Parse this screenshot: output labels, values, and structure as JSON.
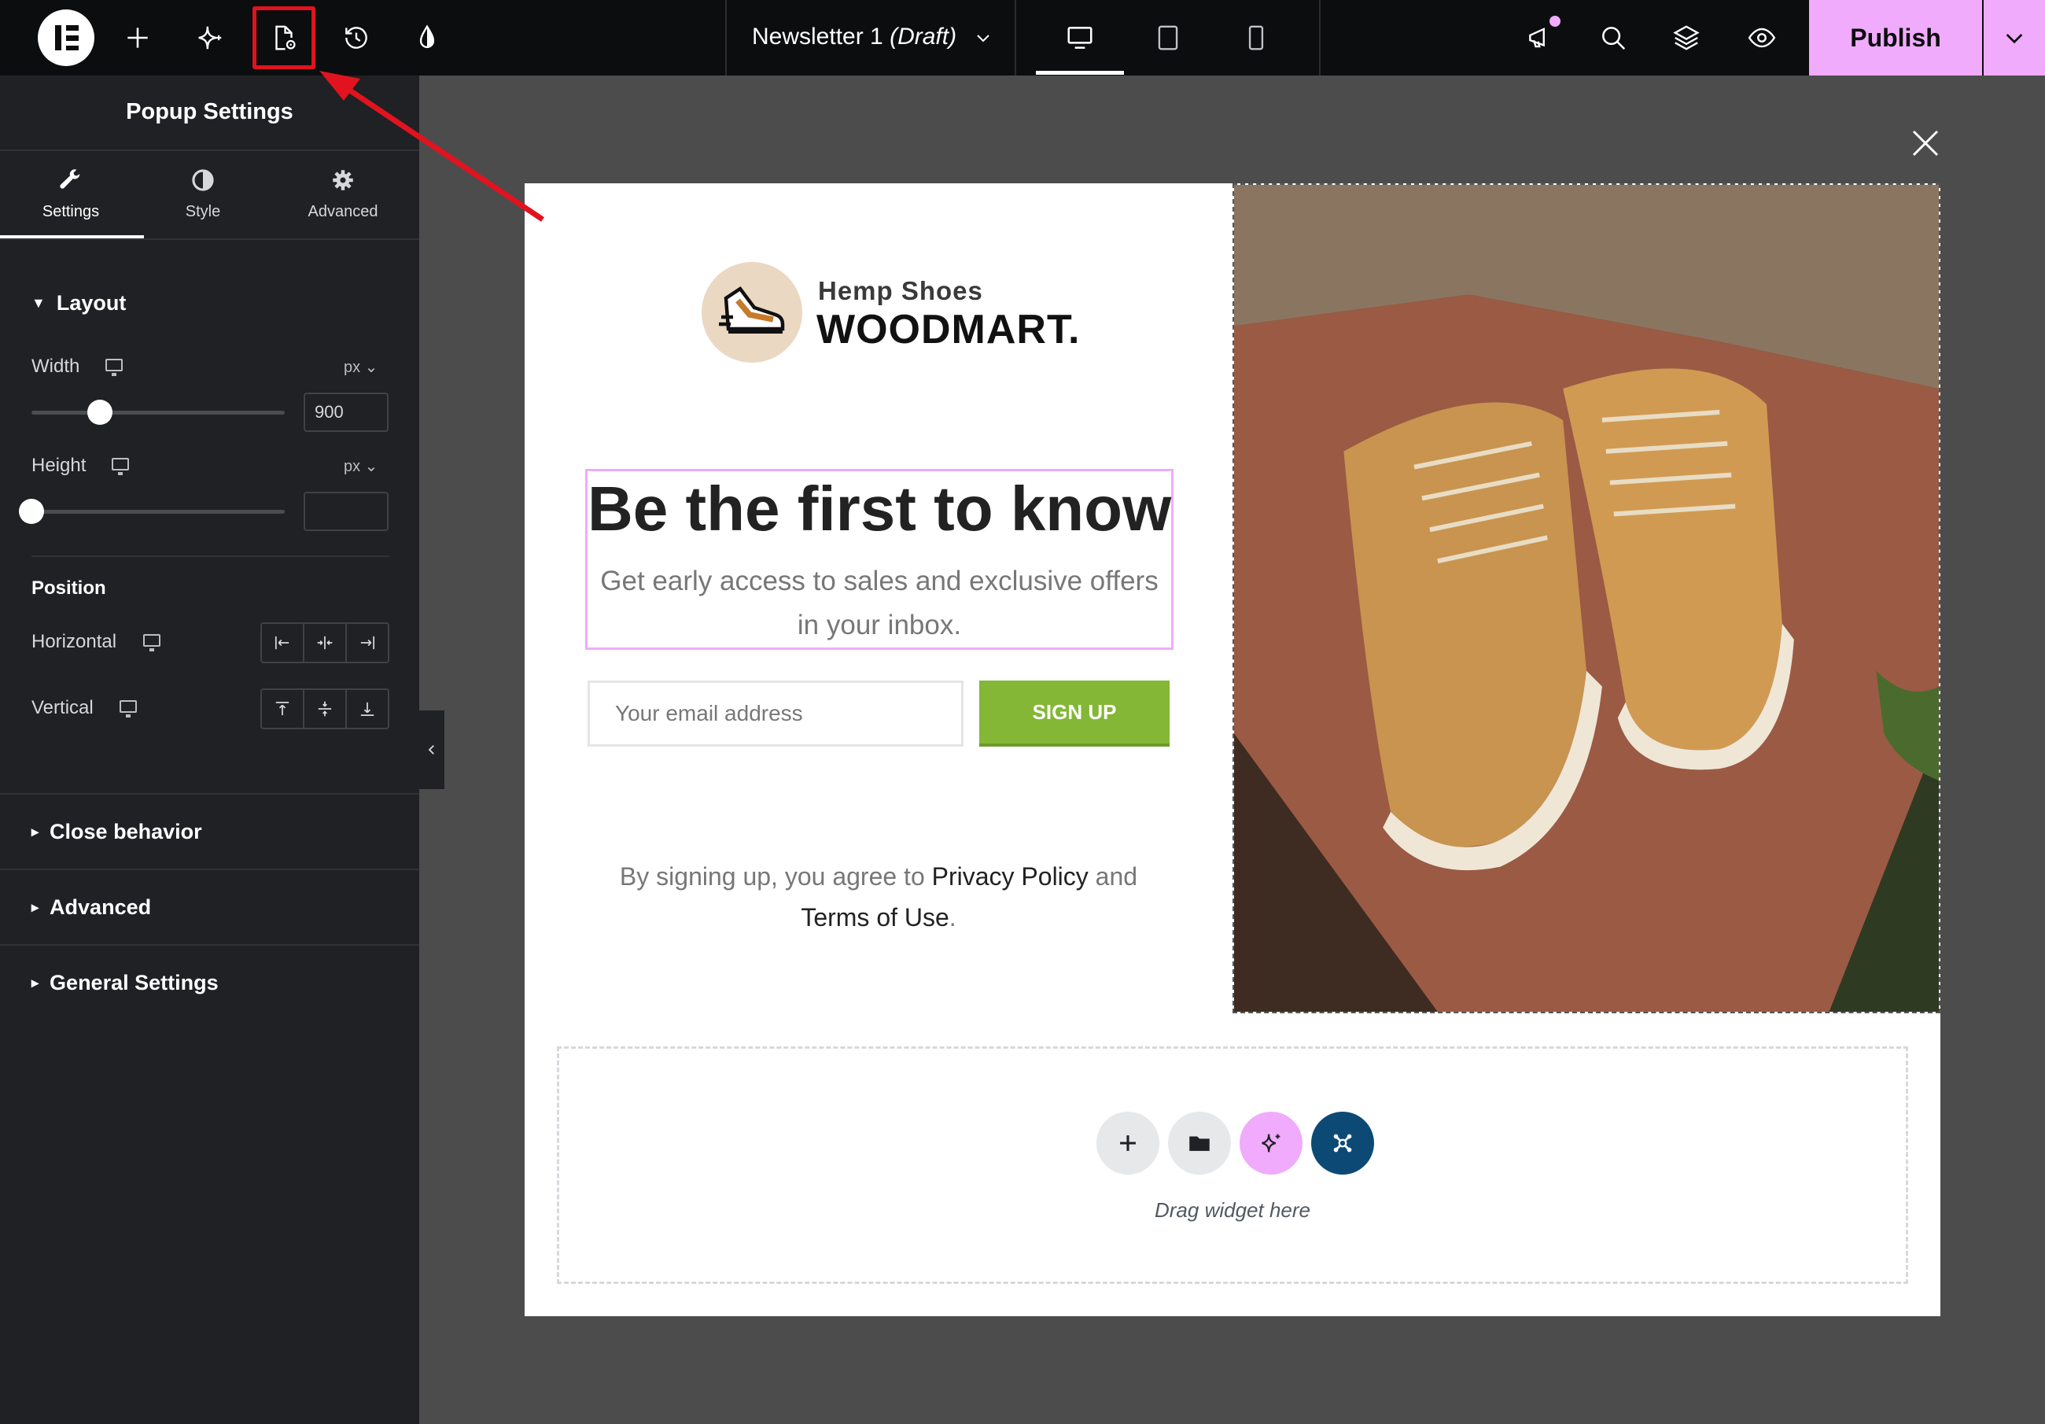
{
  "topbar": {
    "document_title": "Newsletter 1",
    "document_status": "(Draft)",
    "publish_label": "Publish",
    "icons": [
      "elementor-logo-icon",
      "add-icon",
      "ai-sparkle-icon",
      "page-settings-icon",
      "history-icon",
      "site-style-icon",
      "desktop-icon",
      "tablet-icon",
      "mobile-icon",
      "notifications-icon",
      "search-icon",
      "structure-layers-icon",
      "preview-eye-icon",
      "chevron-down-icon"
    ]
  },
  "panel": {
    "title": "Popup Settings",
    "tabs": [
      {
        "label": "Settings",
        "icon": "wrench-icon"
      },
      {
        "label": "Style",
        "icon": "contrast-icon"
      },
      {
        "label": "Advanced",
        "icon": "gear-icon"
      }
    ],
    "layout": {
      "heading": "Layout",
      "width": {
        "label": "Width",
        "unit": "px",
        "value": "900",
        "slider_fraction": 0.27
      },
      "height": {
        "label": "Height",
        "unit": "px",
        "value": "",
        "slider_fraction": 0.0
      }
    },
    "position": {
      "heading": "Position",
      "horizontal": "Horizontal",
      "vertical": "Vertical"
    },
    "sections": [
      "Close behavior",
      "Advanced",
      "General Settings"
    ]
  },
  "popup": {
    "brand_small": "Hemp Shoes",
    "brand_big": "WOODMART.",
    "headline": "Be the first to know",
    "subline": "Get early access to sales and exclusive offers in your inbox.",
    "email_placeholder": "Your email address",
    "signup_label": "SIGN UP",
    "legal_prefix": "By signing up, you agree to ",
    "legal_privacy": "Privacy Policy",
    "legal_and": " and ",
    "legal_terms": "Terms of Use",
    "legal_suffix": ".",
    "dropzone_text": "Drag widget here"
  },
  "colors": {
    "accent_pink": "#f0abfc",
    "signup_green": "#83b735",
    "highlight_red": "#e0131f",
    "panel_bg": "#1f2124",
    "canvas_bg": "#4c4c4c"
  }
}
